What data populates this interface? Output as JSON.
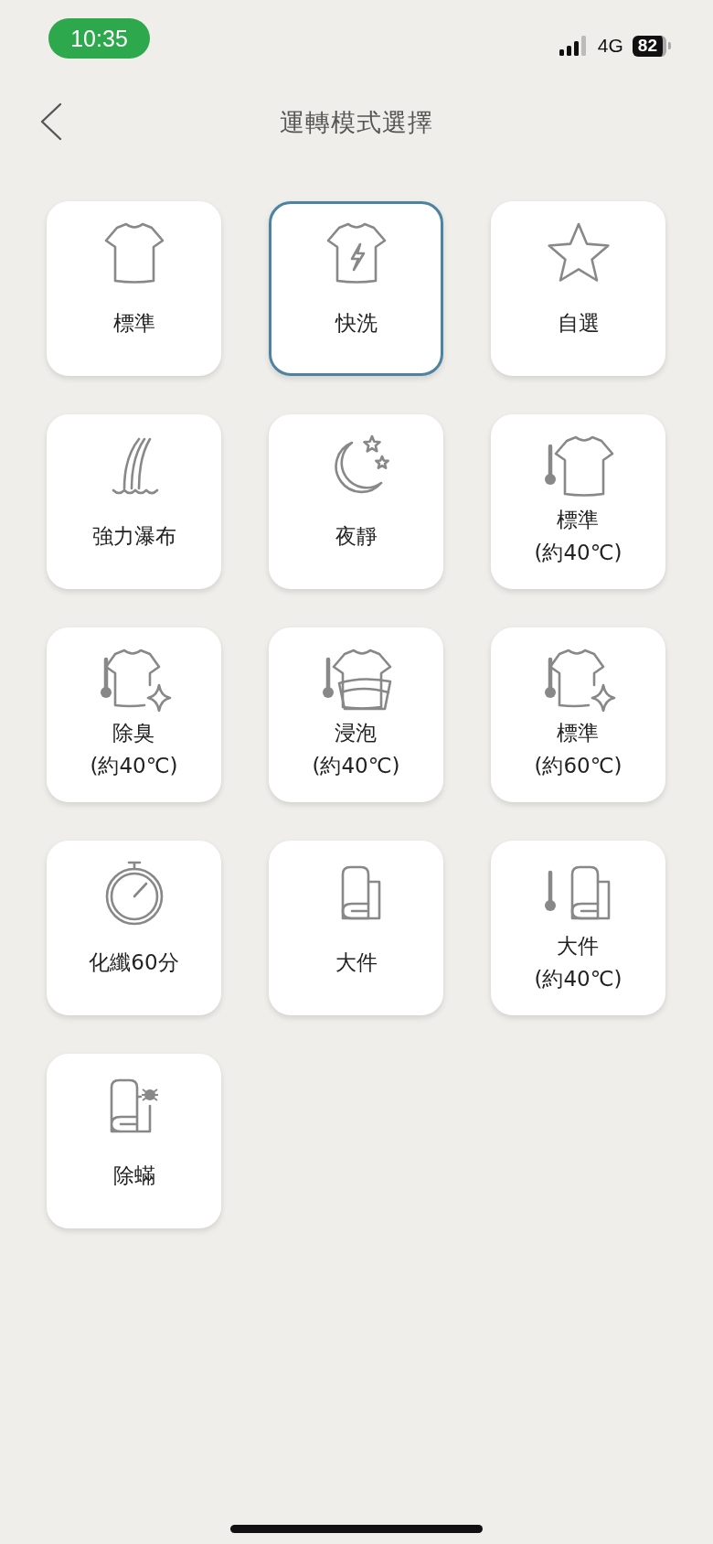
{
  "status_bar": {
    "time": "10:35",
    "network": "4G",
    "battery": "82"
  },
  "header": {
    "title": "運轉模式選擇"
  },
  "modes": [
    {
      "kind": "shirt",
      "label": "標準",
      "selected": false
    },
    {
      "kind": "shirt-bolt",
      "label": "快洗",
      "selected": true
    },
    {
      "kind": "star",
      "label": "自選",
      "selected": false
    },
    {
      "kind": "waterfall",
      "label": "強力瀑布",
      "selected": false
    },
    {
      "kind": "moon",
      "label": "夜靜",
      "selected": false
    },
    {
      "kind": "shirt-thermo",
      "label": "標準",
      "note": "(約40℃)",
      "selected": false
    },
    {
      "kind": "shirt-thermo-sparkle",
      "label": "除臭",
      "note": "(約40℃)",
      "selected": false
    },
    {
      "kind": "basin-thermo",
      "label": "浸泡",
      "note": "(約40℃)",
      "selected": false
    },
    {
      "kind": "shirt-thermo-sparkle",
      "label": "標準",
      "note": "(約60℃)",
      "selected": false
    },
    {
      "kind": "stopwatch",
      "label": "化纖60分",
      "selected": false
    },
    {
      "kind": "towel",
      "label": "大件",
      "selected": false
    },
    {
      "kind": "towel-thermo",
      "label": "大件",
      "note": "(約40℃)",
      "selected": false
    },
    {
      "kind": "towel-bug",
      "label": "除蟎",
      "selected": false
    }
  ]
}
